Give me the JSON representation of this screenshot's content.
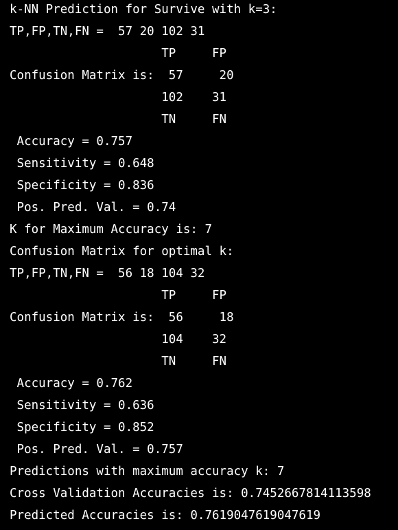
{
  "theme": {
    "background": "#000000",
    "text": "#ffffff"
  },
  "console": {
    "lines": [
      "k-NN Prediction for Survive with k=3:",
      "TP,FP,TN,FN =  57 20 102 31",
      "                     TP     FP",
      "Confusion Matrix is:  57     20",
      "                     102    31",
      "                     TN     FN",
      " Accuracy = 0.757",
      " Sensitivity = 0.648",
      " Specificity = 0.836",
      " Pos. Pred. Val. = 0.74",
      "K for Maximum Accuracy is: 7",
      "Confusion Matrix for optimal k:",
      "TP,FP,TN,FN =  56 18 104 32",
      "                     TP     FP",
      "Confusion Matrix is:  56     18",
      "                     104    32",
      "                     TN     FN",
      " Accuracy = 0.762",
      " Sensitivity = 0.636",
      " Specificity = 0.852",
      " Pos. Pred. Val. = 0.757",
      "Predictions with maximum accuracy k: 7",
      "Cross Validation Accuracies is: 0.7452667814113598",
      "Predicted Accuracies is: 0.7619047619047619"
    ]
  }
}
